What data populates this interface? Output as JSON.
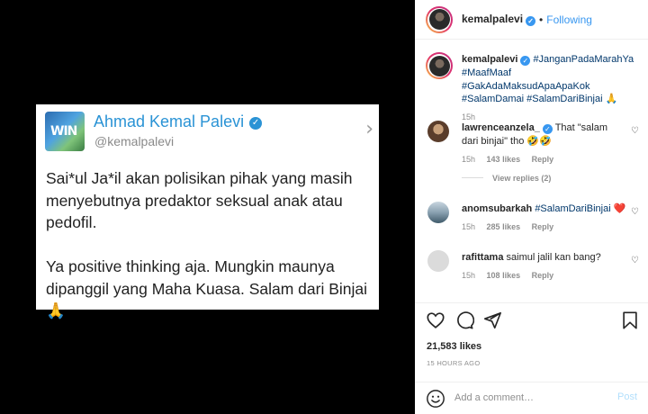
{
  "tweet": {
    "avatar_text": "WIN",
    "name": "Ahmad Kemal Palevi",
    "handle": "@kemalpalevi",
    "paragraphs": [
      "Sai*ul Ja*il akan polisikan pihak yang masih\nmenyebutnya predaktor seksual anak atau\npedofil.",
      "Ya positive thinking aja. Mungkin maunya\ndipanggil yang Maha Kuasa. Salam dari Binjai\n🙏"
    ]
  },
  "header": {
    "username": "kemalpalevi",
    "separator": "•",
    "follow_status": "Following"
  },
  "caption": {
    "username": "kemalpalevi",
    "hashtags": "#JanganPadaMarahYa #MaafMaaf #GakAdaMaksudApaApaKok #SalamDamai #SalamDariBinjai",
    "emoji": "🙏",
    "time": "15h"
  },
  "comments": [
    {
      "username": "lawrenceanzela_",
      "text": "That \"salam dari binjai\" tho 🤣🤣",
      "time": "15h",
      "likes": "143 likes",
      "reply": "Reply",
      "view_replies": "View replies (2)"
    },
    {
      "username": "anomsubarkah",
      "text": "#SalamDariBinjai ❤️",
      "time": "15h",
      "likes": "285 likes",
      "reply": "Reply"
    },
    {
      "username": "rafittama",
      "text": "saimul jalil kan bang?",
      "time": "15h",
      "likes": "108 likes",
      "reply": "Reply"
    }
  ],
  "likes": "21,583 likes",
  "time_ago": "15 HOURS AGO",
  "add_comment": {
    "placeholder": "Add a comment…",
    "post_label": "Post"
  },
  "icons": {
    "like": "heart-icon",
    "comment": "comment-icon",
    "share": "share-icon",
    "save": "bookmark-icon",
    "emoji": "emoji-icon"
  },
  "colors": {
    "link_blue": "#3897f0",
    "tweet_blue": "#2a93d5",
    "hashtag": "#00376b",
    "heart_red": "#ed4956"
  }
}
